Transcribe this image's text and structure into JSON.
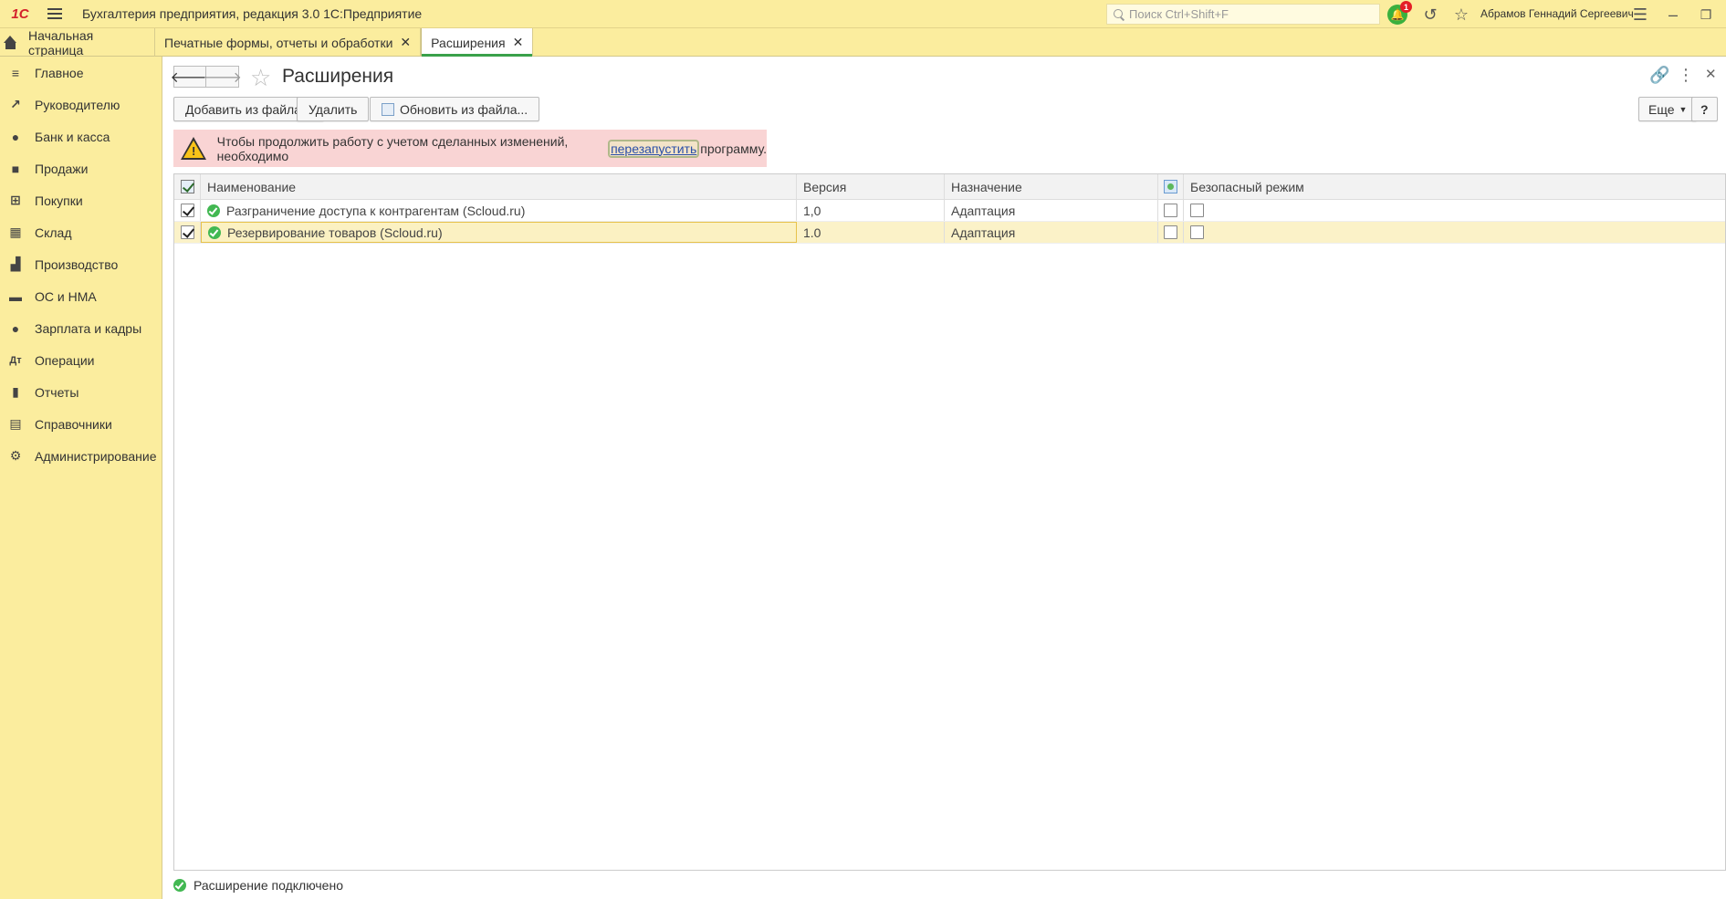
{
  "titlebar": {
    "logo": "1С",
    "app_title": "Бухгалтерия предприятия, редакция 3.0 1С:Предприятие",
    "search_placeholder": "Поиск Ctrl+Shift+F",
    "notifications_count": "1",
    "user_name": "Абрамов Геннадий Сергеевич"
  },
  "tabs": [
    {
      "label": "Начальная страница"
    },
    {
      "label": "Печатные формы, отчеты и обработки"
    },
    {
      "label": "Расширения"
    }
  ],
  "sidebar": {
    "items": [
      {
        "label": "Главное",
        "icon": "menu-lines-icon"
      },
      {
        "label": "Руководителю",
        "icon": "trend-icon"
      },
      {
        "label": "Банк и касса",
        "icon": "coin-icon"
      },
      {
        "label": "Продажи",
        "icon": "bag-icon"
      },
      {
        "label": "Покупки",
        "icon": "cart-icon"
      },
      {
        "label": "Склад",
        "icon": "grid-icon"
      },
      {
        "label": "Производство",
        "icon": "factory-icon"
      },
      {
        "label": "ОС и НМА",
        "icon": "truck-icon"
      },
      {
        "label": "Зарплата и кадры",
        "icon": "person-icon"
      },
      {
        "label": "Операции",
        "icon": "operations-icon"
      },
      {
        "label": "Отчеты",
        "icon": "bar-chart-icon"
      },
      {
        "label": "Справочники",
        "icon": "book-icon"
      },
      {
        "label": "Администрирование",
        "icon": "gear-icon"
      }
    ]
  },
  "page": {
    "title": "Расширения",
    "buttons": {
      "add_from_file": "Добавить из файла...",
      "delete": "Удалить",
      "update_from_file": "Обновить из файла...",
      "more": "Еще",
      "help": "?"
    },
    "warning": {
      "text_before": "Чтобы продолжить работу с учетом сделанных изменений, необходимо",
      "link": "перезапустить",
      "text_after": "программу."
    },
    "table": {
      "columns": [
        "Наименование",
        "Версия",
        "Назначение",
        "Безопасный режим"
      ],
      "rows": [
        {
          "name": "Разграничение доступа к контрагентам (Scloud.ru)",
          "version": "1,0",
          "purpose": "Адаптация",
          "active": true,
          "flag1": false,
          "safe_mode": false
        },
        {
          "name": "Резервирование товаров (Scloud.ru)",
          "version": "1.0",
          "purpose": "Адаптация",
          "active": true,
          "flag1": false,
          "safe_mode": false
        }
      ]
    },
    "status": "Расширение подключено"
  },
  "colors": {
    "panel_bg": "#fbed9e",
    "active_tab_underline": "#3aa14a",
    "warning_bg": "#f9d4d4",
    "selected_row_bg": "#fbf2c8",
    "ok_green": "#42b852"
  }
}
